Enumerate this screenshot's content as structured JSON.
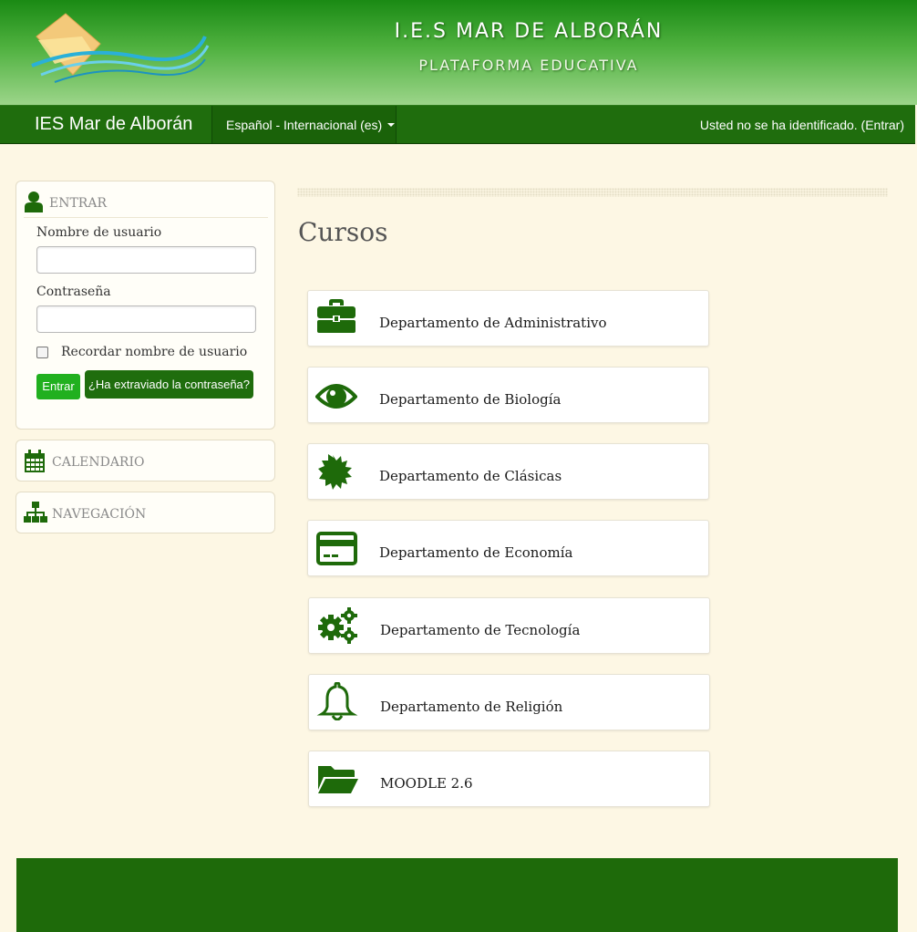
{
  "banner": {
    "title": "I.E.S MAR DE ALBORÁN",
    "subtitle": "PLATAFORMA EDUCATIVA"
  },
  "navbar": {
    "brand": "IES Mar de Alborán",
    "language": "Español - Internacional (es)",
    "login_status": "Usted no se ha identificado. (Entrar)"
  },
  "login_block": {
    "title": "ENTRAR",
    "icon": "user-icon",
    "username_label": "Nombre de usuario",
    "username_value": "",
    "password_label": "Contraseña",
    "password_value": "",
    "remember_label": "Recordar nombre de usuario",
    "remember_checked": false,
    "submit_label": "Entrar",
    "forgot_label": "¿Ha extraviado la contraseña?"
  },
  "calendar_block": {
    "title": "CALENDARIO",
    "icon": "calendar-icon"
  },
  "navigation_block": {
    "title": "NAVEGACIÓN",
    "icon": "sitemap-icon"
  },
  "main": {
    "title": "Cursos",
    "courses": [
      {
        "name": "Departamento de Administrativo",
        "icon": "briefcase-icon"
      },
      {
        "name": "Departamento de Biología",
        "icon": "eye-icon"
      },
      {
        "name": "Departamento de Clásicas",
        "icon": "certificate-icon"
      },
      {
        "name": "Departamento de Economía",
        "icon": "credit-card-icon"
      },
      {
        "name": "Departamento de Tecnología",
        "icon": "cogs-icon"
      },
      {
        "name": "Departamento de Religión",
        "icon": "bell-icon"
      },
      {
        "name": "MOODLE 2.6",
        "icon": "folder-open-icon"
      }
    ]
  },
  "colors": {
    "brand_green": "#1f6d0d",
    "icon_green": "#1e6a0a",
    "button_green": "#21b01f",
    "page_background": "#fdf7e4"
  }
}
